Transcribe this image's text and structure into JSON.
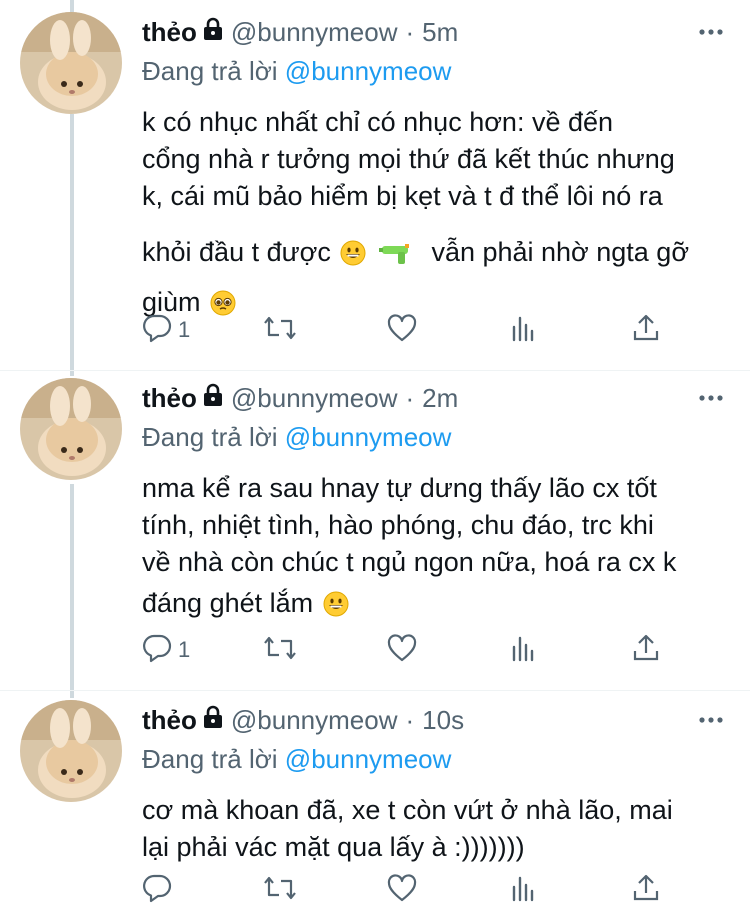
{
  "colors": {
    "text": "#0f1419",
    "secondary": "#536471",
    "link": "#1d9bf0",
    "thread_line": "#cfd9de",
    "divider": "#eff3f4"
  },
  "tweets": [
    {
      "name": "thẻo",
      "handle": "@bunnymeow",
      "separator": "·",
      "time": "5m",
      "reply_prefix": "Đang trả lời",
      "reply_mention": "@bunnymeow",
      "lines": [
        "k có nhục nhất chỉ có nhục hơn: về đến",
        "cổng nhà r tưởng mọi thứ đã kết thúc nhưng",
        "k, cái mũ bảo hiểm bị kẹt và t đ thể lôi nó ra",
        "khỏi đầu t được",
        "vẫn phải nhờ ngta gỡ",
        "giùm"
      ],
      "reply_count": "1"
    },
    {
      "name": "thẻo",
      "handle": "@bunnymeow",
      "separator": "·",
      "time": "2m",
      "reply_prefix": "Đang trả lời",
      "reply_mention": "@bunnymeow",
      "lines": [
        "nma kể ra sau hnay tự dưng thấy lão cx tốt",
        "tính, nhiệt tình, hào phóng, chu đáo, trc khi",
        "về nhà còn chúc t ngủ ngon nữa, hoá ra cx k",
        "đáng ghét lắm"
      ],
      "reply_count": "1"
    },
    {
      "name": "thẻo",
      "handle": "@bunnymeow",
      "separator": "·",
      "time": "10s",
      "reply_prefix": "Đang trả lời",
      "reply_mention": "@bunnymeow",
      "lines": [
        "cơ mà khoan đã, xe t còn vứt ở nhà lão, mai",
        "lại phải vác mặt qua lấy à :)))))))"
      ],
      "reply_count": ""
    }
  ],
  "icons": {
    "lock": "lock-icon",
    "more": "more-icon",
    "reply": "reply-icon",
    "retweet": "retweet-icon",
    "like": "heart-icon",
    "analytics": "analytics-icon",
    "share": "share-icon",
    "emoji_grin": "grinning-face-emoji",
    "emoji_pistol": "water-pistol-emoji",
    "emoji_pleading": "pleading-face-emoji"
  }
}
